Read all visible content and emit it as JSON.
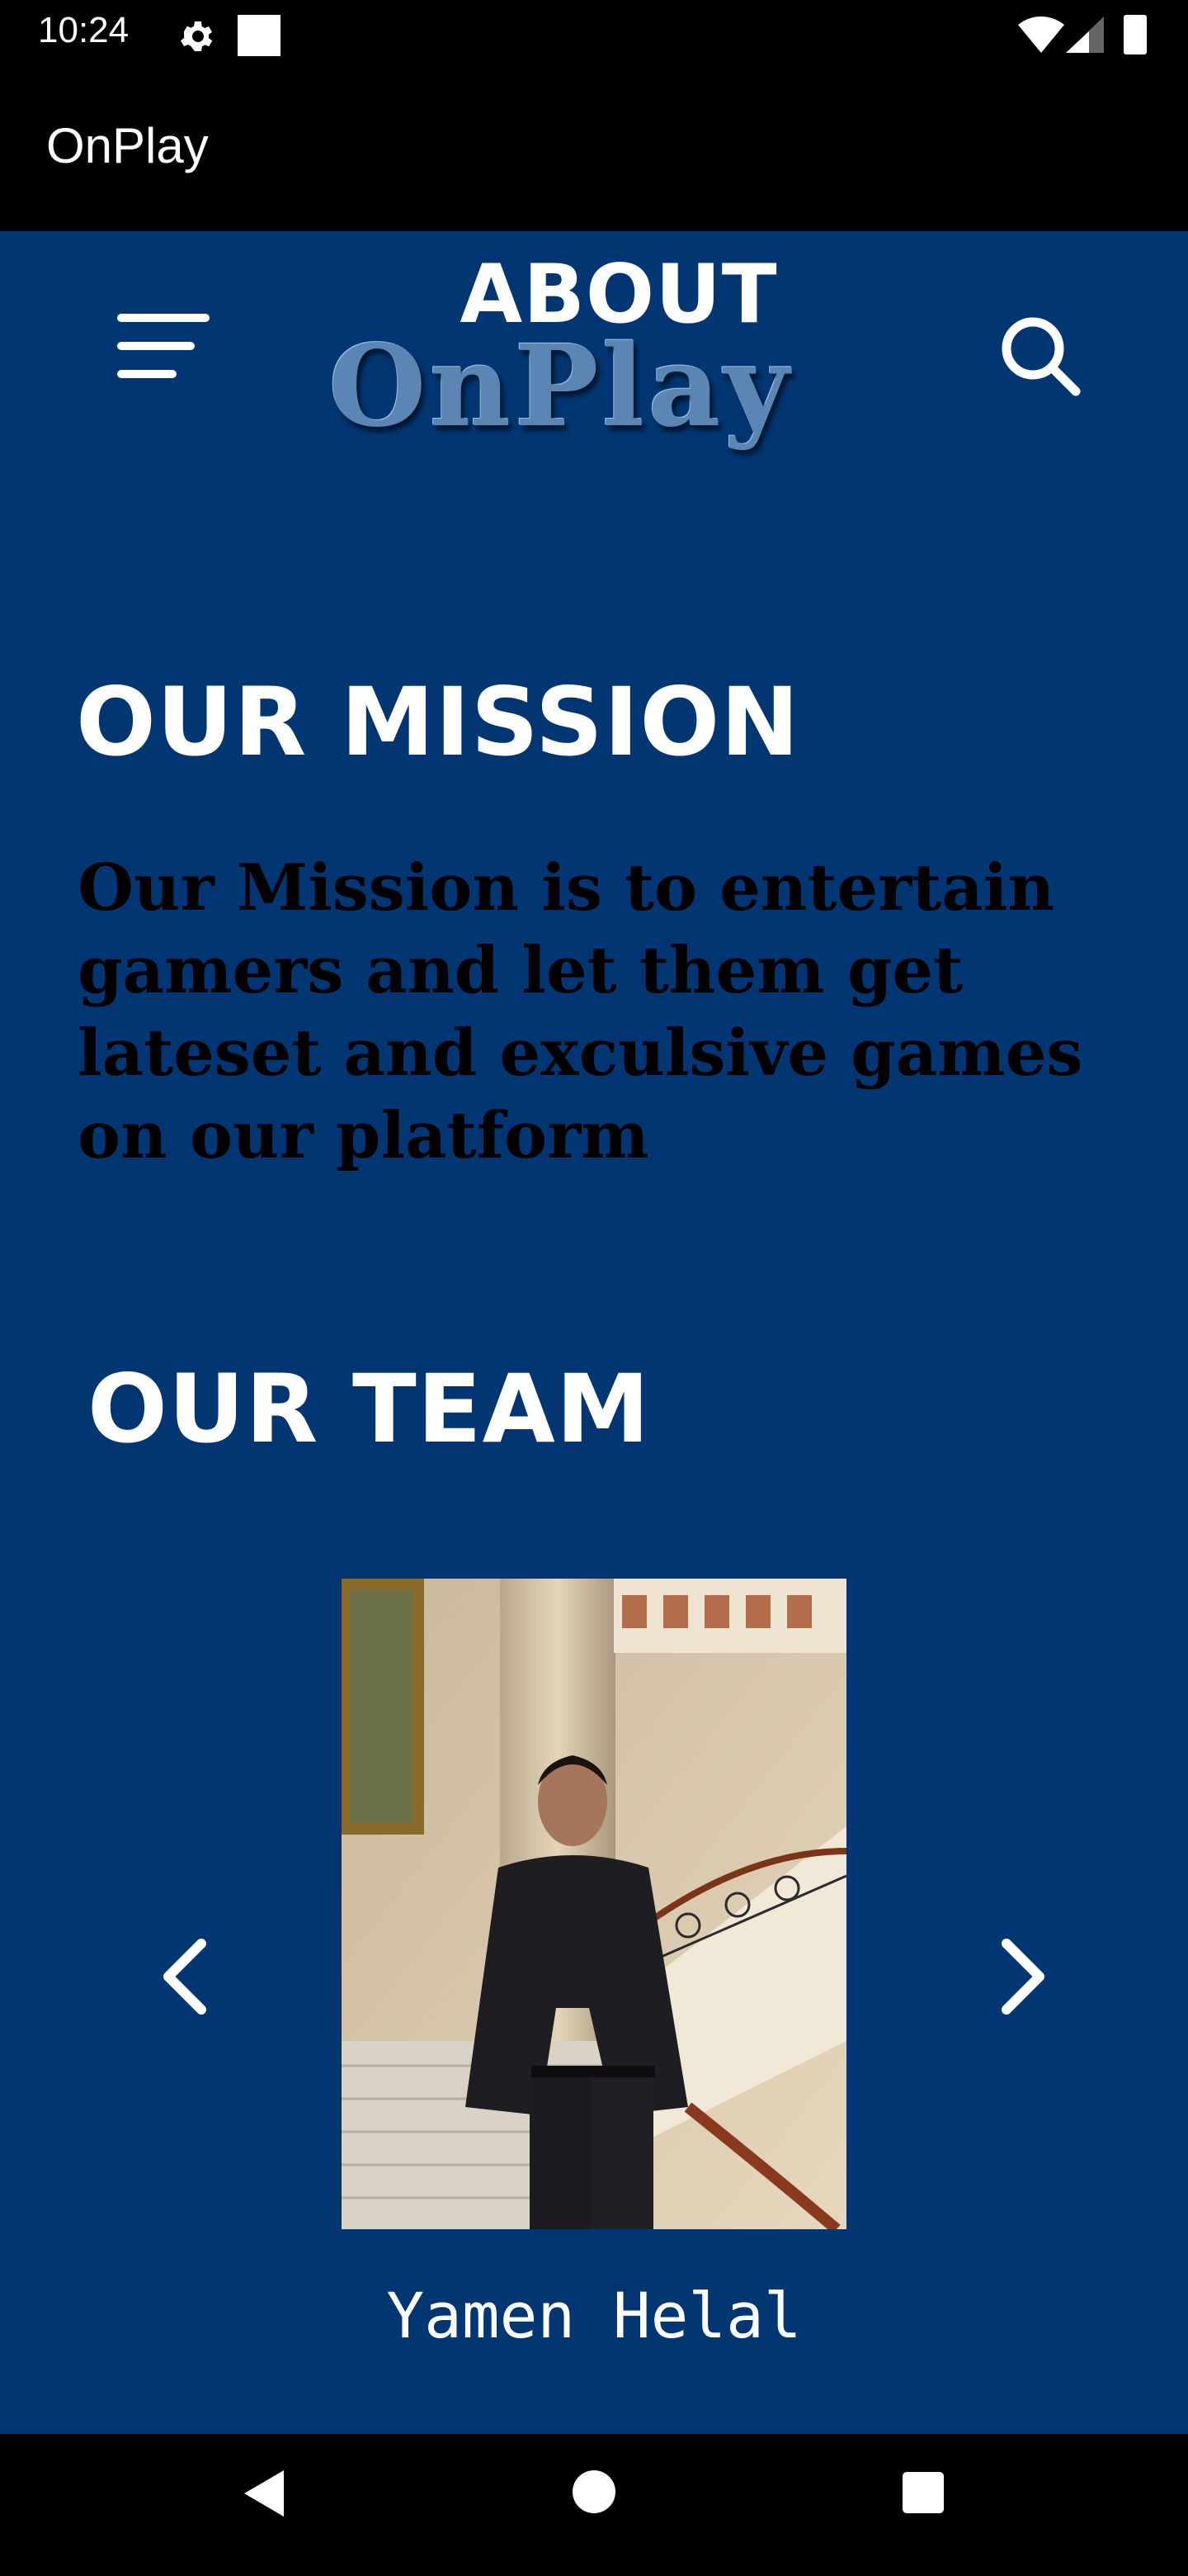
{
  "status_bar": {
    "time": "10:24",
    "icons": [
      "settings-icon",
      "square-notification-icon",
      "wifi-icon",
      "signal-icon",
      "battery-icon"
    ]
  },
  "app_bar": {
    "title": "OnPlay"
  },
  "header": {
    "logo_text": "OnPlay",
    "menu_icon": "menu-icon",
    "search_icon": "search-icon"
  },
  "about": {
    "title": "ABOUT",
    "mission_title": "OUR MISSION",
    "mission_text": "Our Mission is to entertain gamers and let them get lateset and exculsive games on our platform",
    "team_title": "OUR TEAM"
  },
  "team": {
    "member_name": "Yamen Helal",
    "prev_icon": "chevron-left-icon",
    "next_icon": "chevron-right-icon"
  },
  "colors": {
    "background": "#023672",
    "text": "#FFFFFF",
    "mission_text": "#000000",
    "logo": "#5B86B4"
  },
  "nav_bar": {
    "icons": [
      "back-icon",
      "home-icon",
      "recents-icon"
    ]
  }
}
